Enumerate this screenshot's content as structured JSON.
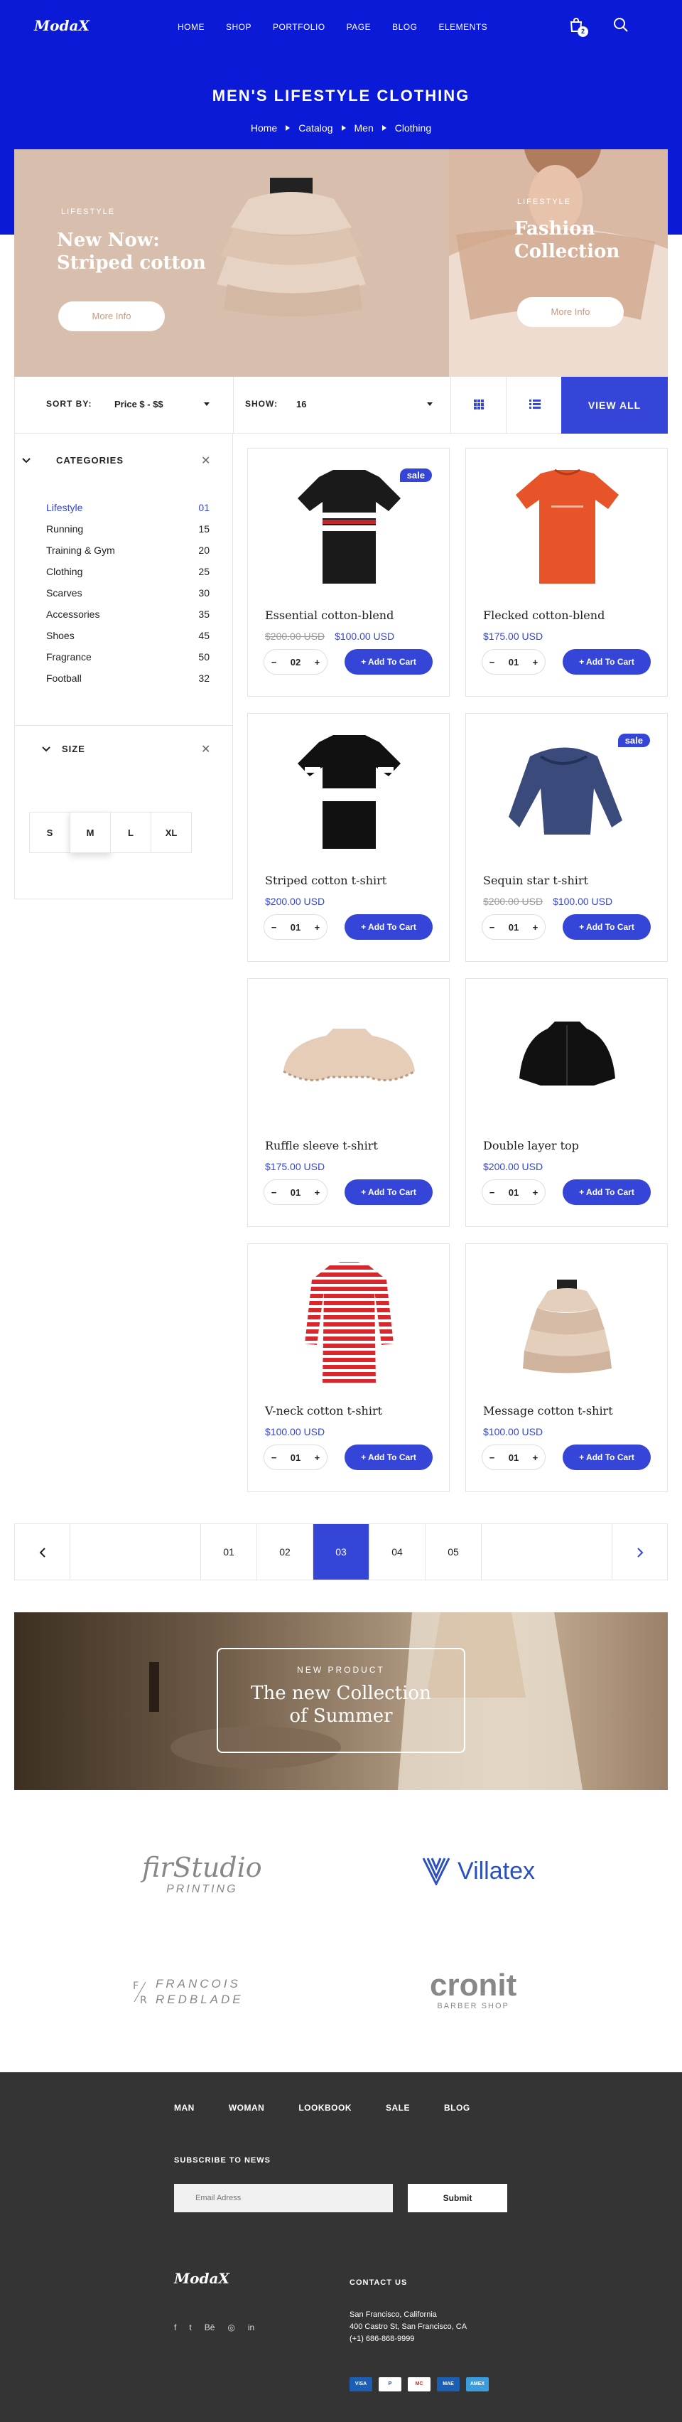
{
  "header": {
    "logo": "ModaX",
    "nav": [
      "HOME",
      "SHOP",
      "PORTFOLIO",
      "PAGE",
      "BLOG",
      "ELEMENTS"
    ],
    "cart_count": "2"
  },
  "page": {
    "title": "MEN'S LIFESTYLE CLOTHING",
    "breadcrumb": [
      "Home",
      "Catalog",
      "Men",
      "Clothing"
    ]
  },
  "banners": [
    {
      "kicker": "LIFESTYLE",
      "title": "New Now: Striped cotton",
      "button": "More Info"
    },
    {
      "kicker": "LIFESTYLE",
      "title": "Fashion Collection",
      "button": "More Info"
    }
  ],
  "toolbar": {
    "sort_label": "SORT BY:",
    "sort_value": "Price $ - $$",
    "show_label": "SHOW:",
    "show_value": "16",
    "view_all": "VIEW ALL"
  },
  "sidebar": {
    "categories_title": "CATEGORIES",
    "categories": [
      {
        "name": "Lifestyle",
        "count": "01",
        "active": true
      },
      {
        "name": "Running",
        "count": "15"
      },
      {
        "name": "Training & Gym",
        "count": "20"
      },
      {
        "name": "Clothing",
        "count": "25"
      },
      {
        "name": "Scarves",
        "count": "30"
      },
      {
        "name": "Accessories",
        "count": "35"
      },
      {
        "name": "Shoes",
        "count": "45"
      },
      {
        "name": "Fragrance",
        "count": "50"
      },
      {
        "name": "Football",
        "count": "32"
      }
    ],
    "size_title": "SIZE",
    "sizes": [
      "S",
      "M",
      "L",
      "XL"
    ],
    "selected_size": "M"
  },
  "products": [
    {
      "name": "Essential cotton-blend",
      "old_price": "$200.00 USD",
      "price": "$100.00 USD",
      "qty": "02",
      "button": "+ Add To Cart",
      "badge": "sale",
      "image": "black-striped-polo"
    },
    {
      "name": "Flecked cotton-blend",
      "old_price": "",
      "price": "$175.00 USD",
      "qty": "01",
      "button": "+ Add To Cart",
      "badge": "",
      "image": "orange-tshirt"
    },
    {
      "name": "Striped cotton t-shirt",
      "old_price": "",
      "price": "$200.00 USD",
      "qty": "01",
      "button": "+ Add To Cart",
      "badge": "",
      "image": "black-white-polo"
    },
    {
      "name": "Sequin star t-shirt",
      "old_price": "$200.00 USD",
      "price": "$100.00 USD",
      "qty": "01",
      "button": "+ Add To Cart",
      "badge": "sale",
      "image": "blue-sweater"
    },
    {
      "name": "Ruffle sleeve t-shirt",
      "old_price": "",
      "price": "$175.00 USD",
      "qty": "01",
      "button": "+ Add To Cart",
      "badge": "",
      "image": "beige-cape"
    },
    {
      "name": "Double layer top",
      "old_price": "",
      "price": "$200.00 USD",
      "qty": "01",
      "button": "+ Add To Cart",
      "badge": "",
      "image": "black-jacket"
    },
    {
      "name": "V-neck cotton t-shirt",
      "old_price": "",
      "price": "$100.00 USD",
      "qty": "01",
      "button": "+ Add To Cart",
      "badge": "",
      "image": "red-striped-shirt"
    },
    {
      "name": "Message cotton t-shirt",
      "old_price": "",
      "price": "$100.00 USD",
      "qty": "01",
      "button": "+ Add To Cart",
      "badge": "",
      "image": "ruffle-top"
    }
  ],
  "pagination": {
    "pages": [
      "01",
      "02",
      "03",
      "04",
      "05"
    ],
    "active": "03"
  },
  "promo": {
    "kicker": "NEW PRODUCT",
    "title": "The new Collection of Summer"
  },
  "brands": [
    {
      "name": "firStudio",
      "sub": "PRINTING"
    },
    {
      "name": "Villatex",
      "sub": ""
    },
    {
      "name": "FRANCOIS REDBLADE",
      "sub": ""
    },
    {
      "name": "cronit",
      "sub": "BARBER SHOP"
    }
  ],
  "footer": {
    "nav": [
      "MAN",
      "WOMAN",
      "LOOKBOOK",
      "SALE",
      "BLOG"
    ],
    "subscribe_title": "SUBSCRIBE TO NEWS",
    "email_placeholder": "Email Adress",
    "submit": "Submit",
    "logo": "ModaX",
    "contact_title": "CONTACT US",
    "address": [
      "San Francisco, California",
      "400 Castro St, San Francisco, CA",
      "(+1) 686-868-9999"
    ],
    "social": [
      "f",
      "t",
      "Bē",
      "◎",
      "in"
    ],
    "payments": [
      "VISA",
      "P",
      "MC",
      "MAE",
      "AMEX"
    ]
  },
  "colors": {
    "accent": "#3445d8",
    "hero": "#0b1ad6",
    "footer": "#343434"
  }
}
